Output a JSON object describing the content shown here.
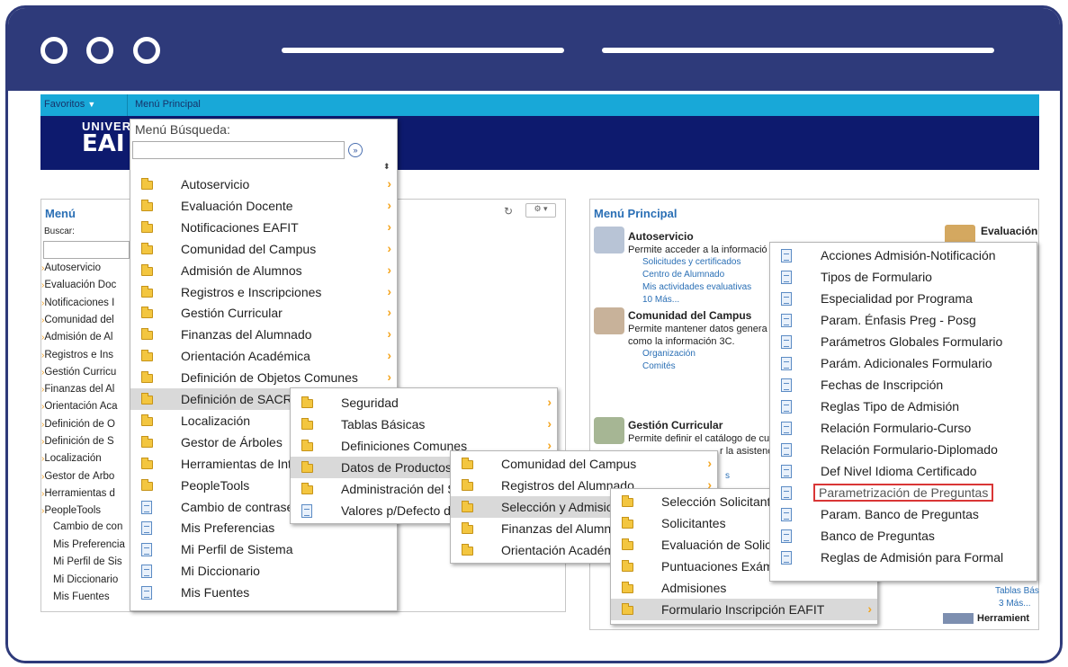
{
  "browser": {
    "dots": 3
  },
  "topbar": {
    "favoritos": "Favoritos",
    "menu_principal": "Menú Principal"
  },
  "logo": {
    "line1": "UNIVER",
    "line2": "EAI"
  },
  "search_popup": {
    "title": "Menú Búsqueda:",
    "search_value": "",
    "items": [
      {
        "label": "Autoservicio",
        "icon": "folder",
        "arrow": true
      },
      {
        "label": "Evaluación Docente",
        "icon": "folder",
        "arrow": true
      },
      {
        "label": "Notificaciones EAFIT",
        "icon": "folder",
        "arrow": true
      },
      {
        "label": "Comunidad del Campus",
        "icon": "folder",
        "arrow": true
      },
      {
        "label": "Admisión de Alumnos",
        "icon": "folder",
        "arrow": true
      },
      {
        "label": "Registros e Inscripciones",
        "icon": "folder",
        "arrow": true
      },
      {
        "label": "Gestión Curricular",
        "icon": "folder",
        "arrow": true
      },
      {
        "label": "Finanzas del Alumnado",
        "icon": "folder",
        "arrow": true
      },
      {
        "label": "Orientación Académica",
        "icon": "folder",
        "arrow": true
      },
      {
        "label": "Definición de Objetos Comunes",
        "icon": "folder",
        "arrow": true
      },
      {
        "label": "Definición de SACR",
        "icon": "folder",
        "arrow": false,
        "selected": true
      },
      {
        "label": "Localización",
        "icon": "folder",
        "arrow": false
      },
      {
        "label": "Gestor de Árboles",
        "icon": "folder",
        "arrow": false
      },
      {
        "label": "Herramientas de Int",
        "icon": "folder",
        "arrow": false
      },
      {
        "label": "PeopleTools",
        "icon": "folder",
        "arrow": false
      },
      {
        "label": "Cambio de contrase",
        "icon": "doc",
        "arrow": false
      },
      {
        "label": "Mis Preferencias",
        "icon": "doc",
        "arrow": false
      },
      {
        "label": "Mi Perfil de Sistema",
        "icon": "doc",
        "arrow": false
      },
      {
        "label": "Mi Diccionario",
        "icon": "doc",
        "arrow": false
      },
      {
        "label": "Mis Fuentes",
        "icon": "doc",
        "arrow": false
      }
    ]
  },
  "submenu1": {
    "items": [
      {
        "label": "Seguridad",
        "icon": "folder",
        "arrow": true
      },
      {
        "label": "Tablas Básicas",
        "icon": "folder",
        "arrow": true
      },
      {
        "label": "Definiciones Comunes",
        "icon": "folder",
        "arrow": true
      },
      {
        "label": "Datos de Productos",
        "icon": "folder",
        "arrow": false,
        "selected": true
      },
      {
        "label": "Administración del S",
        "icon": "folder",
        "arrow": false
      },
      {
        "label": "Valores p/Defecto d",
        "icon": "doc",
        "arrow": false
      }
    ]
  },
  "submenu2": {
    "items": [
      {
        "label": "Comunidad del Campus",
        "icon": "folder",
        "arrow": true
      },
      {
        "label": "Registros del Alumnado",
        "icon": "folder",
        "arrow": true
      },
      {
        "label": "Selección y Admisio",
        "icon": "folder",
        "arrow": false,
        "selected": true
      },
      {
        "label": "Finanzas del Alumn",
        "icon": "folder",
        "arrow": false
      },
      {
        "label": "Orientación Académ",
        "icon": "folder",
        "arrow": false
      }
    ]
  },
  "submenu3": {
    "items": [
      {
        "label": "Selección Solicitant",
        "icon": "folder",
        "arrow": false
      },
      {
        "label": "Solicitantes",
        "icon": "folder",
        "arrow": false
      },
      {
        "label": "Evaluación de Solic",
        "icon": "folder",
        "arrow": false
      },
      {
        "label": "Puntuaciones Exám",
        "icon": "folder",
        "arrow": false
      },
      {
        "label": "Admisiones",
        "icon": "folder",
        "arrow": false
      },
      {
        "label": "Formulario Inscripción EAFIT",
        "icon": "folder",
        "arrow": true,
        "selected": true
      }
    ]
  },
  "submenu4": {
    "items": [
      {
        "label": "Acciones Admisión-Notificación"
      },
      {
        "label": "Tipos de Formulario"
      },
      {
        "label": "Especialidad por Programa"
      },
      {
        "label": "Param. Énfasis Preg - Posg"
      },
      {
        "label": "Parámetros Globales Formulario"
      },
      {
        "label": "Parám. Adicionales Formulario"
      },
      {
        "label": "Fechas de Inscripción"
      },
      {
        "label": "Reglas Tipo de Admisión"
      },
      {
        "label": "Relación Formulario-Curso"
      },
      {
        "label": "Relación Formulario-Diplomado"
      },
      {
        "label": "Def Nivel Idioma Certificado"
      },
      {
        "label": "Parametrización de Preguntas",
        "highlighted": true
      },
      {
        "label": "Param. Banco de Preguntas"
      },
      {
        "label": "Banco de Preguntas"
      },
      {
        "label": "Reglas de Admisión para Formal"
      }
    ]
  },
  "left_menu": {
    "title": "Menú",
    "search_label": "Buscar:",
    "items": [
      "Autoservicio",
      "Evaluación Doc",
      "Notificaciones I",
      "Comunidad del",
      "Admisión de Al",
      "Registros e Ins",
      "Gestión Curricu",
      "Finanzas del Al",
      "Orientación Aca",
      "Definición de O",
      "Definición de S",
      "Localización",
      "Gestor de Árbo",
      "Herramientas d",
      "PeopleTools"
    ],
    "plain_items": [
      "Cambio de con",
      "Mis Preferencia",
      "Mi Perfil de Sis",
      "Mi Diccionario",
      "Mis Fuentes"
    ]
  },
  "right_panel": {
    "title": "Menú Principal",
    "autoservicio": {
      "head": "Autoservicio",
      "desc": "Permite acceder a la informació",
      "links": [
        "Solicitudes y certificados",
        "Centro de Alumnado",
        "Mis actividades evaluativas",
        "10 Más..."
      ]
    },
    "comunidad": {
      "head": "Comunidad del Campus",
      "desc1": "Permite mantener datos genera",
      "desc2": "como la información 3C.",
      "links": [
        "Organización",
        "Comités"
      ]
    },
    "gestion": {
      "head": "Gestión Curricular",
      "desc1": "Permite definir el catálogo de cu",
      "desc2": "r la asistenc",
      "link": "s"
    },
    "evaluacion": "Evaluación",
    "tablas": "Tablas Bás",
    "mas": "3 Más...",
    "herramient": "Herramient"
  }
}
